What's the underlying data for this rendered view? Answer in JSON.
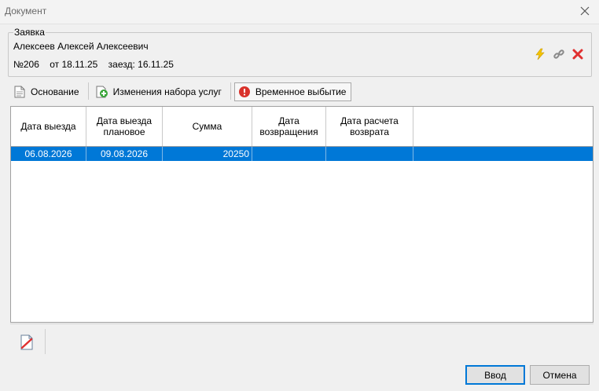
{
  "window": {
    "title": "Документ"
  },
  "request": {
    "legend": "Заявка",
    "guest_name": "Алексеев Алексей Алексеевич",
    "number": "№206",
    "date_text": "от 18.11.25",
    "arrival_text": "заезд: 16.11.25"
  },
  "tabs": [
    {
      "label": "Основание",
      "icon": "document-icon"
    },
    {
      "label": "Изменения набора услуг",
      "icon": "add-icon"
    },
    {
      "label": "Временное выбытие",
      "icon": "warning-icon"
    }
  ],
  "grid": {
    "columns": [
      {
        "label": "Дата выезда"
      },
      {
        "label": "Дата выезда плановое"
      },
      {
        "label": "Сумма"
      },
      {
        "label": "Дата возвращения"
      },
      {
        "label": "Дата расчета возврата"
      }
    ],
    "rows": [
      {
        "departure": "06.08.2026",
        "planned": "09.08.2026",
        "amount": "20250",
        "return_date": "",
        "calc_date": ""
      }
    ]
  },
  "buttons": {
    "ok": "Ввод",
    "cancel": "Отмена"
  },
  "colors": {
    "selection": "#0078d7",
    "flash": "#f5c400",
    "delete": "#e03030"
  }
}
